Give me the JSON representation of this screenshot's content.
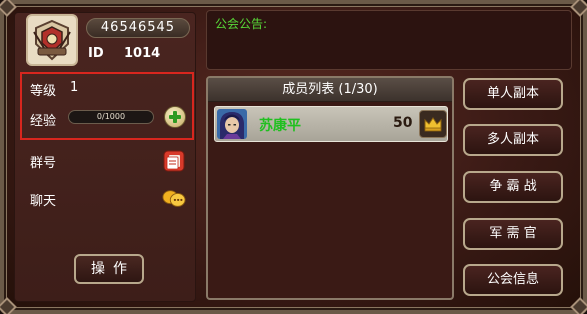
{
  "profile": {
    "score": "46546545",
    "id_label": "ID",
    "id_value": "1014"
  },
  "stats": {
    "level_label": "等级",
    "level_value": "1",
    "exp_label": "经验",
    "exp_text": "0/1000",
    "exp_progress": 0
  },
  "actions": {
    "group_label": "群号",
    "chat_label": "聊天",
    "operate_label": "操作"
  },
  "notice": {
    "title": "公会公告:"
  },
  "members": {
    "header": "成员列表 (1/30)",
    "rows": [
      {
        "name": "苏康平",
        "level": "50"
      }
    ]
  },
  "menu": {
    "solo_dungeon": "单人副本",
    "multi_dungeon": "多人副本",
    "battle": "争 霸 战",
    "quartermaster": "军 需 官",
    "guild_info": "公会信息"
  },
  "colors": {
    "notice_green": "#58d838",
    "name_green": "#20c020",
    "highlight_red": "#d8261e"
  }
}
